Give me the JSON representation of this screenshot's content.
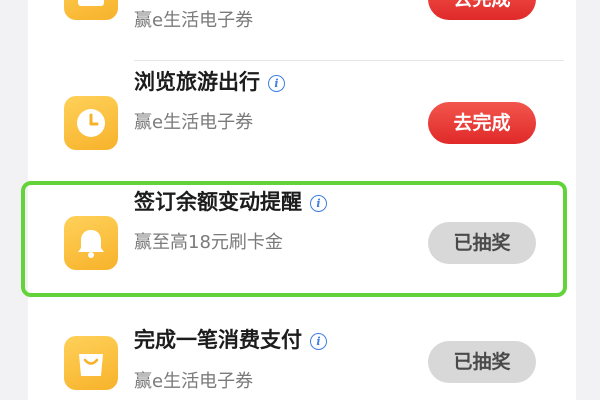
{
  "tasks": [
    {
      "icon": "gift-icon",
      "title": "",
      "subtitle": "赢e生活电子券",
      "button": "去完成",
      "state": "todo"
    },
    {
      "icon": "clock-icon",
      "title": "浏览旅游出行",
      "subtitle": "赢e生活电子券",
      "button": "去完成",
      "state": "todo"
    },
    {
      "icon": "bell-icon",
      "title": "签订余额变动提醒",
      "subtitle": "赢至高18元刷卡金",
      "button": "已抽奖",
      "state": "done"
    },
    {
      "icon": "shopping-bag-icon",
      "title": "完成一笔消费支付",
      "subtitle": "赢e生活电子券",
      "button": "已抽奖",
      "state": "done"
    }
  ],
  "info_glyph": "i",
  "colors": {
    "todo_button": "#e83a36",
    "done_button": "#d8d8d8",
    "icon_bg": "#f8bd35",
    "highlight": "#62d43a",
    "info": "#3f7fe0"
  }
}
